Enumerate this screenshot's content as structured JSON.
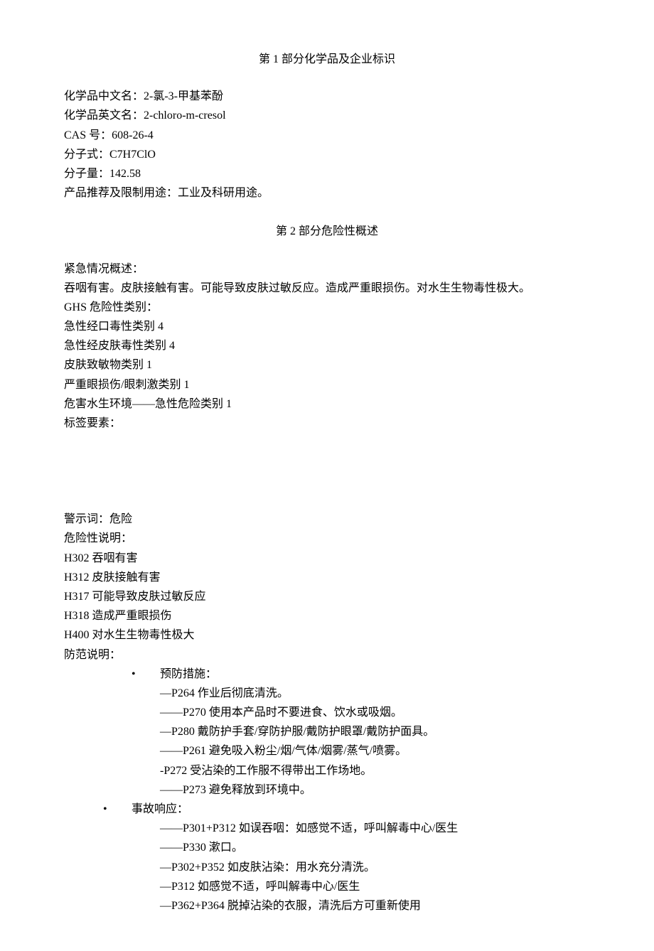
{
  "section1": {
    "title": "第 1 部分化学品及企业标识",
    "l1": "化学品中文名：2-氯-3-甲基苯酚",
    "l2": "化学品英文名：2-chloro-m-cresol",
    "l3": "CAS 号：608-26-4",
    "l4": "分子式：C7H7ClO",
    "l5": "分子量：142.58",
    "l6": "产品推荐及限制用途：工业及科研用途。"
  },
  "section2": {
    "title": "第 2 部分危险性概述",
    "l1": "紧急情况概述：",
    "l2": "吞咽有害。皮肤接触有害。可能导致皮肤过敏反应。造成严重眼损伤。对水生生物毒性极大。",
    "l3": "GHS 危险性类别：",
    "l4": "急性经口毒性类别 4",
    "l5": "急性经皮肤毒性类别 4",
    "l6": "皮肤致敏物类别 1",
    "l7": "严重眼损伤/眼刺激类别 1",
    "l8": "危害水生环境——急性危险类别 1",
    "l9": "标签要素：",
    "l10": "警示词：危险",
    "l11": "危险性说明：",
    "l12": "H302 吞咽有害",
    "l13": "H312 皮肤接触有害",
    "l14": "H317 可能导致皮肤过敏反应",
    "l15": "H318 造成严重眼损伤",
    "l16": "H400 对水生生物毒性极大",
    "l17": "防范说明：",
    "prevention": {
      "label": "预防措施：",
      "p1": "—P264 作业后彻底清洗。",
      "p2": "——P270 使用本产品时不要进食、饮水或吸烟。",
      "p3": "—P280 戴防护手套/穿防护服/戴防护眼罩/戴防护面具。",
      "p4": "——P261 避免吸入粉尘/烟/气体/烟雾/蒸气/喷雾。",
      "p5": "-P272 受沾染的工作服不得带出工作场地。",
      "p6": "——P273 避免释放到环境中。"
    },
    "response": {
      "label": "事故响应：",
      "p1": "——P301+P312 如误吞咽：如感觉不适，呼叫解毒中心/医生",
      "p2": "——P330 漱口。",
      "p3": "—P302+P352 如皮肤沾染：用水充分清洗。",
      "p4": "—P312 如感觉不适，呼叫解毒中心/医生",
      "p5": "—P362+P364 脱掉沾染的衣服，清洗后方可重新使用"
    }
  }
}
